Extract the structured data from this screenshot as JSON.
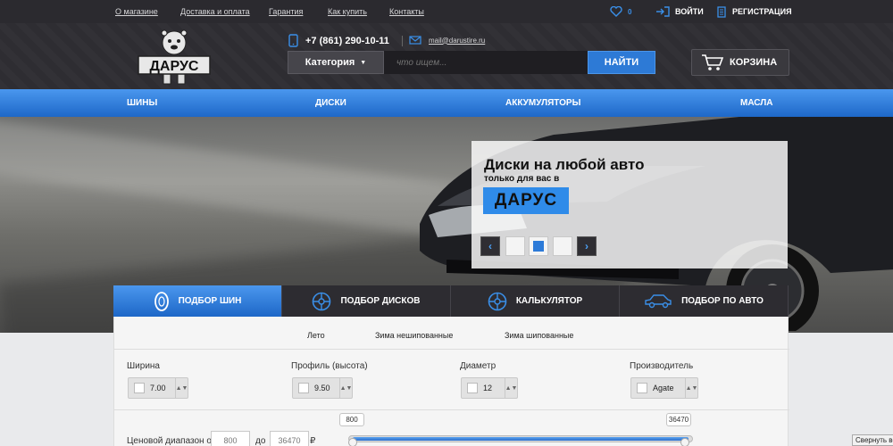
{
  "topbar": {
    "links": [
      "О магазине",
      "Доставка и оплата",
      "Гарантия",
      "Как купить",
      "Контакты"
    ],
    "wishlist_count": "0",
    "login": "ВОЙТИ",
    "register": "РЕГИСТРАЦИЯ"
  },
  "header": {
    "logo_text": "ДАРУС",
    "phone": "+7 (861) 290-10-11",
    "email": "mail@darustire.ru",
    "category_label": "Категория",
    "search_placeholder": "что ищем...",
    "search_button": "НАЙТИ",
    "cart_label": "КОРЗИНА"
  },
  "nav": [
    "ШИНЫ",
    "ДИСКИ",
    "АККУМУЛЯТОРЫ",
    "МАСЛА"
  ],
  "hero": {
    "title": "Диски на любой авто",
    "subtitle": "только для вас в",
    "brand": "ДАРУС",
    "prev": "‹",
    "next": "›"
  },
  "tabs": [
    "ПОДБОР ШИН",
    "ПОДБОР ДИСКОВ",
    "КАЛЬКУЛЯТОР",
    "ПОДБОР ПО АВТО"
  ],
  "filter": {
    "seasons": [
      "Лето",
      "Зима нешипованные",
      "Зима шипованные"
    ],
    "fields": [
      {
        "label": "Ширина",
        "value": "7.00"
      },
      {
        "label": "Профиль (высота)",
        "value": "9.50"
      },
      {
        "label": "Диаметр",
        "value": "12"
      },
      {
        "label": "Производитель",
        "value": "Agate"
      }
    ],
    "price_label": "Ценовой диапазон от",
    "price_from": "800",
    "price_to_label": "до",
    "price_to": "36470",
    "currency": "₽",
    "range_min_tip": "800",
    "range_max_tip": "36470"
  },
  "collapse_button": "Свернуть все"
}
